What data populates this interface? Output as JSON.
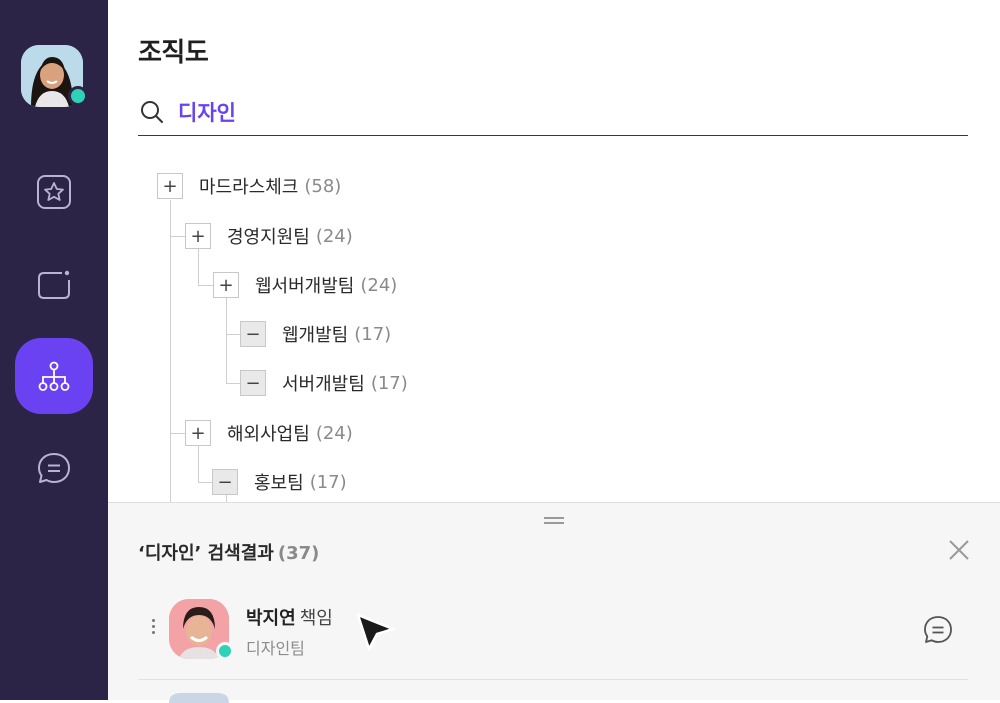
{
  "page": {
    "title": "조직도"
  },
  "search": {
    "value": "디자인",
    "icon": "search-icon"
  },
  "sidebar": {
    "nav": [
      {
        "id": "favorites",
        "icon": "star-icon",
        "active": false
      },
      {
        "id": "cards",
        "icon": "card-icon",
        "active": false
      },
      {
        "id": "organization",
        "icon": "org-chart-icon",
        "active": true
      },
      {
        "id": "chat",
        "icon": "chat-icon",
        "active": false
      }
    ]
  },
  "tree": {
    "nodes": [
      {
        "label": "마드라스체크",
        "count": "(58)",
        "toggle": "+"
      },
      {
        "label": "경영지원팀",
        "count": "(24)",
        "toggle": "+"
      },
      {
        "label": "웹서버개발팀",
        "count": "(24)",
        "toggle": "+"
      },
      {
        "label": "웹개발팀",
        "count": "(17)",
        "toggle": "−"
      },
      {
        "label": "서버개발팀",
        "count": "(17)",
        "toggle": "−"
      },
      {
        "label": "해외사업팀",
        "count": "(24)",
        "toggle": "+"
      },
      {
        "label": "홍보팀",
        "count": "(17)",
        "toggle": "−"
      }
    ]
  },
  "results": {
    "title": "‘디자인’ 검색결과",
    "count": "(37)",
    "items": [
      {
        "name": "박지연",
        "role": "책임",
        "team": "디자인팀",
        "online": true
      }
    ]
  },
  "colors": {
    "sidebar": "#2b2446",
    "accent": "#6a42f2",
    "online": "#2ed3b7"
  }
}
